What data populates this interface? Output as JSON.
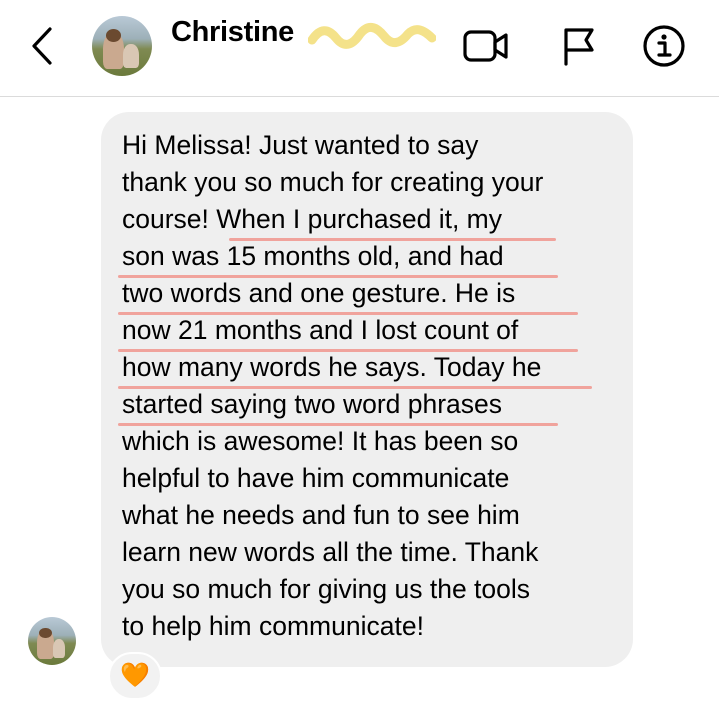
{
  "header": {
    "contact_name": "Christine",
    "icons": [
      "chevron-left-icon",
      "video-camera-icon",
      "flag-icon",
      "info-icon"
    ]
  },
  "message": {
    "lines": [
      "Hi Melissa! Just wanted to say",
      "thank you so much for creating your",
      "course! When I purchased it, my",
      "son was 15 months old, and had",
      "two words and one gesture. He is",
      "now 21 months and I lost count of",
      "how many words he says. Today he",
      "started saying two word phrases",
      "which is awesome! It has been so",
      "helpful to have him communicate",
      "what he needs and fun to see him",
      "learn new words all the time. Thank",
      "you so much for giving us the tools",
      "to help him communicate!"
    ]
  },
  "reaction": {
    "emoji": "🧡"
  },
  "colors": {
    "bubble": "#efefef",
    "highlight_underline": "#f0a39c",
    "squiggle_highlight": "#f4e28a",
    "divider": "#dbdbdb"
  }
}
